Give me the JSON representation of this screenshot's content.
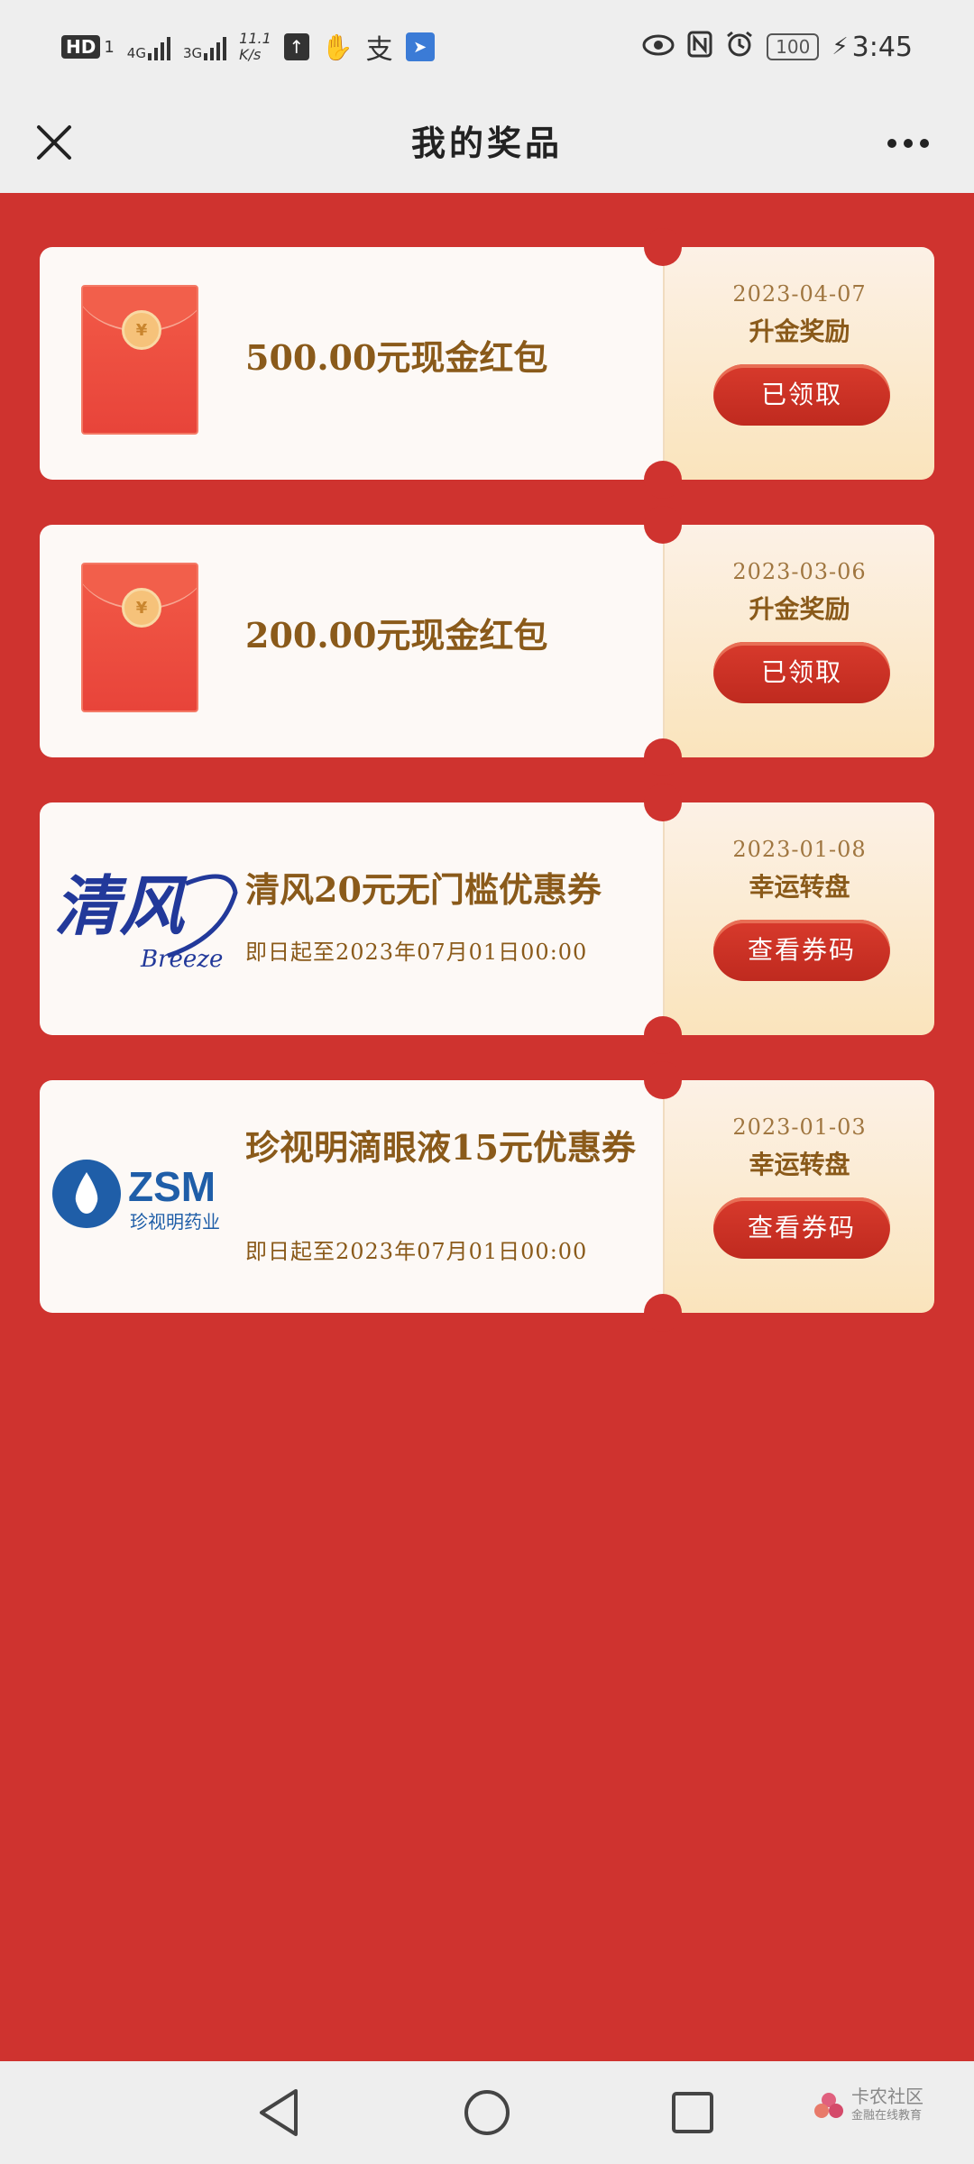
{
  "status_bar": {
    "hd_label": "HD",
    "sim1": "1",
    "net1": "4G",
    "net2": "3G",
    "speed": "11.1",
    "speed_unit": "K/s",
    "alipay_glyph": "支",
    "battery": "100",
    "time": "3:45",
    "left_icons": [
      "hd-badge",
      "signal-4g-icon",
      "signal-3g-icon",
      "upload-icon",
      "hand-icon",
      "alipay-icon",
      "app-icon"
    ],
    "right_icons": [
      "eye-icon",
      "nfc-icon",
      "alarm-icon",
      "battery-icon",
      "charging-icon"
    ]
  },
  "header": {
    "title": "我的奖品",
    "close_icon": "close-icon",
    "more_icon": "more-icon"
  },
  "prizes": [
    {
      "image": "red-envelope",
      "title": "500.00元现金红包",
      "validity": "",
      "date": "2023-04-07",
      "source": "升金奖励",
      "action": "已领取"
    },
    {
      "image": "red-envelope",
      "title": "200.00元现金红包",
      "validity": "",
      "date": "2023-03-06",
      "source": "升金奖励",
      "action": "已领取"
    },
    {
      "image": "qingfeng-logo",
      "title": "清风20元无门槛优惠券",
      "validity": "即日起至2023年07月01日00:00",
      "date": "2023-01-08",
      "source": "幸运转盘",
      "action": "查看券码",
      "logo_text": "清风",
      "logo_sub": "Breeze"
    },
    {
      "image": "zsm-logo",
      "title": "珍视明滴眼液15元优惠券",
      "validity": "即日起至2023年07月01日00:00",
      "date": "2023-01-03",
      "source": "幸运转盘",
      "action": "查看券码",
      "logo_text": "ZSM",
      "logo_sub": "珍视明药业"
    }
  ],
  "nav_bar": {
    "back_icon": "back-triangle-icon",
    "home_icon": "home-circle-icon",
    "recents_icon": "recents-square-icon",
    "watermark_title": "卡农社区",
    "watermark_sub": "金融在线教育"
  },
  "colors": {
    "background": "#cf332f",
    "title_text": "#8a5a1a",
    "button": "#c8302a",
    "bar_background": "#eeeeee"
  }
}
